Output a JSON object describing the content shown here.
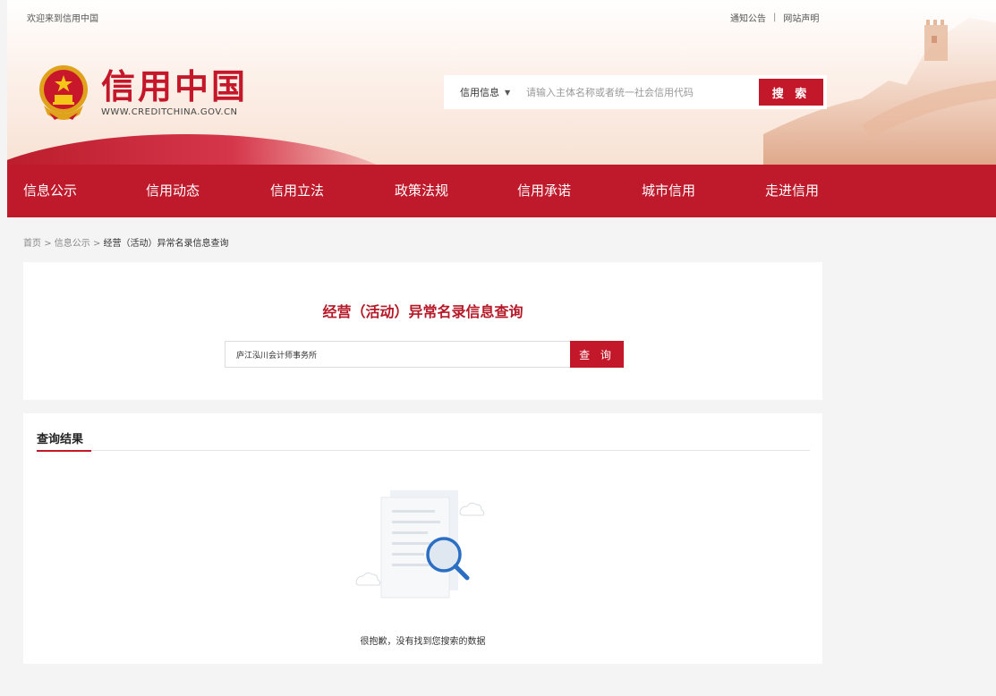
{
  "topbar": {
    "welcome": "欢迎来到信用中国",
    "links": [
      "通知公告",
      "网站声明"
    ],
    "separator": "|"
  },
  "logo": {
    "title": "信用中国",
    "url": "WWW.CREDITCHINA.GOV.CN"
  },
  "search": {
    "category": "信用信息",
    "placeholder": "请输入主体名称或者统一社会信用代码",
    "button": "搜 索"
  },
  "nav": {
    "items": [
      "信息公示",
      "信用动态",
      "信用立法",
      "政策法规",
      "信用承诺",
      "城市信用",
      "走进信用"
    ]
  },
  "breadcrumb": {
    "home": "首页",
    "sep": ">",
    "section": "信息公示",
    "current": "经营（活动）异常名录信息查询"
  },
  "query": {
    "title": "经营（活动）异常名录信息查询",
    "value": "庐江泓川会计师事务所",
    "button": "查 询"
  },
  "result": {
    "tab": "查询结果",
    "empty_message": "很抱歉，没有找到您搜索的数据"
  },
  "colors": {
    "brand_red": "#c31829",
    "nav_bg": "#bf1a2c",
    "page_bg": "#f4f4f4"
  },
  "icons": [
    "national-emblem-icon",
    "dropdown-caret-icon",
    "empty-search-illustration-icon"
  ]
}
